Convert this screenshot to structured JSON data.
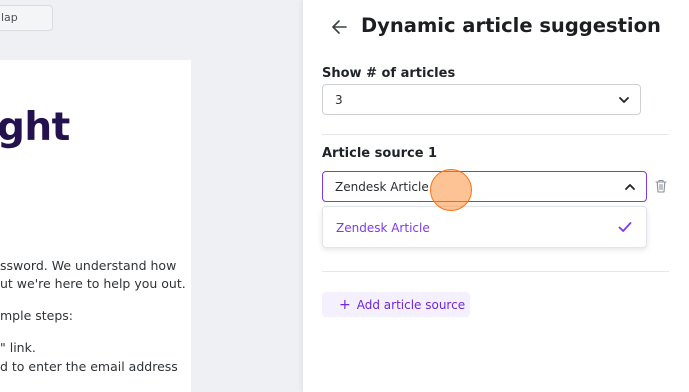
{
  "left": {
    "top_chip_label": "lap",
    "headline": "ght",
    "paragraph_lines": [
      "ssword. We understand how",
      "ut we're here to help you out.",
      "mple steps:",
      "\" link.",
      "d to enter the email address"
    ]
  },
  "panel": {
    "title": "Dynamic article suggestion",
    "show_articles": {
      "label": "Show # of articles",
      "value": "3"
    },
    "article_source": {
      "label": "Article source 1",
      "value": "Zendesk Article",
      "options": [
        {
          "label": "Zendesk Article",
          "selected": true
        }
      ]
    },
    "add_source_label": "Add article source"
  },
  "colors": {
    "accent": "#7c3aed",
    "headline": "#23124d",
    "cursor": "#f97316"
  }
}
